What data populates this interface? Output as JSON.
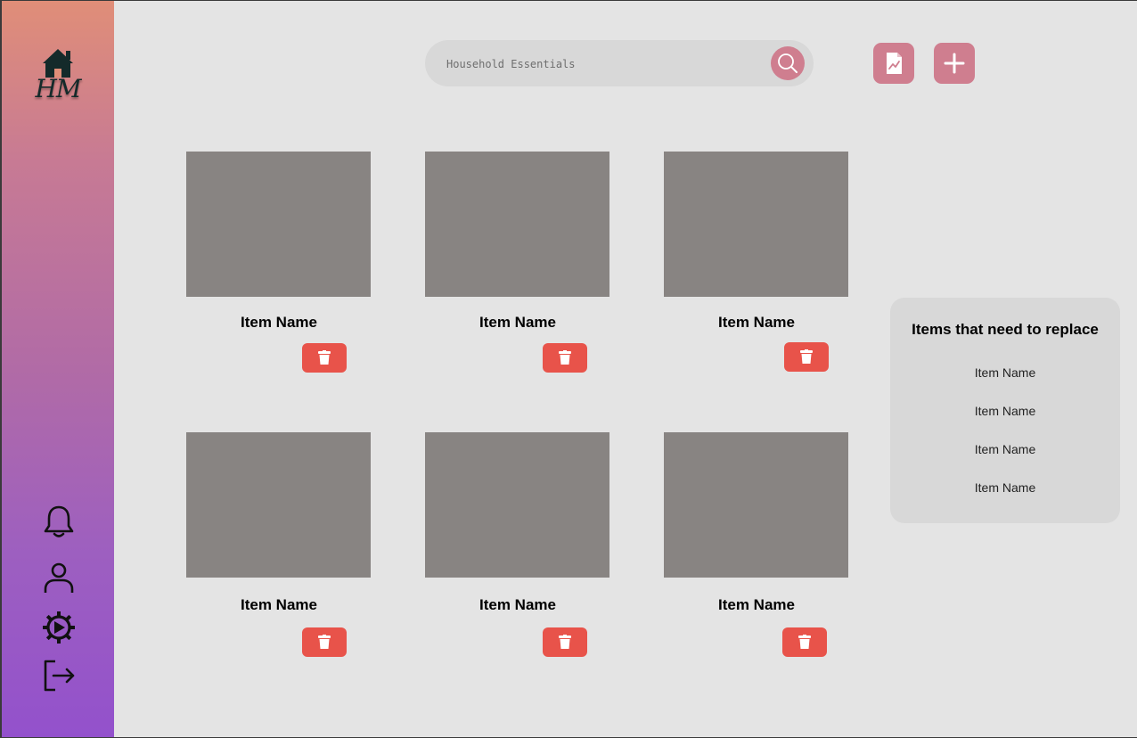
{
  "app": {
    "logo_text": "HM",
    "accent_color": "#cf7e8f",
    "delete_color": "#e8534a"
  },
  "sidebar": {
    "top_icon": "house-icon",
    "bottom_icons": [
      "bell-icon",
      "user-icon",
      "gear-icon",
      "logout-icon"
    ]
  },
  "header": {
    "search": {
      "placeholder": "Household Essentials",
      "value": ""
    },
    "search_icon": "search-icon",
    "report_icon": "report-document-icon",
    "add_icon": "plus-icon"
  },
  "grid": {
    "items": [
      {
        "name": "Item Name",
        "delete_icon": "trash-icon"
      },
      {
        "name": "Item Name",
        "delete_icon": "trash-icon"
      },
      {
        "name": "Item Name",
        "delete_icon": "trash-icon"
      },
      {
        "name": "Item Name",
        "delete_icon": "trash-icon"
      },
      {
        "name": "Item Name",
        "delete_icon": "trash-icon"
      },
      {
        "name": "Item Name",
        "delete_icon": "trash-icon"
      }
    ]
  },
  "replace_panel": {
    "title": "Items that need to replace",
    "items": [
      "Item Name",
      "Item Name",
      "Item Name",
      "Item Name"
    ]
  }
}
